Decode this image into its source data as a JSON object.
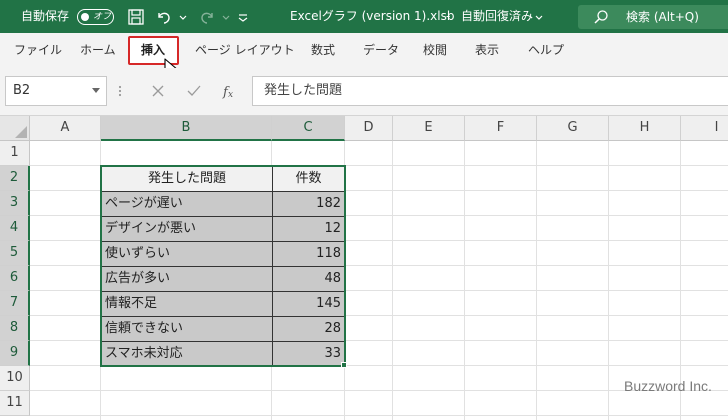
{
  "titlebar": {
    "autosave_label": "自動保存",
    "autosave_state": "オフ",
    "doc_title": "Excelグラフ (version 1).xlsb",
    "separator": "-",
    "save_status": "自動回復済み",
    "search_text": "検索 (Alt+Q)",
    "icons": [
      "save-icon",
      "undo-icon",
      "redo-icon",
      "customize-qat-icon",
      "search-icon"
    ],
    "bg_color": "#217346"
  },
  "ribbon": {
    "tabs": [
      "ファイル",
      "ホーム",
      "挿入",
      "ページ レイアウト",
      "数式",
      "データ",
      "校閲",
      "表示",
      "ヘルプ"
    ],
    "active_tab": "挿入",
    "highlight_color": "#d62828"
  },
  "formula_bar": {
    "name_box": "B2",
    "content": "発生した問題",
    "icons": [
      "cancel-icon",
      "confirm-icon",
      "function-icon"
    ]
  },
  "grid": {
    "columns": [
      "A",
      "B",
      "C",
      "D",
      "E",
      "F",
      "G",
      "H",
      "I"
    ],
    "rows": [
      "1",
      "2",
      "3",
      "4",
      "5",
      "6",
      "7",
      "8",
      "9",
      "10",
      "11"
    ],
    "table": {
      "headers": [
        "発生した問題",
        "件数"
      ],
      "rows": [
        {
          "problem": "ページが遅い",
          "count": "182"
        },
        {
          "problem": "デザインが悪い",
          "count": "12"
        },
        {
          "problem": "使いずらい",
          "count": "118"
        },
        {
          "problem": "広告が多い",
          "count": "48"
        },
        {
          "problem": "情報不足",
          "count": "145"
        },
        {
          "problem": "信頼できない",
          "count": "28"
        },
        {
          "problem": "スマホ未対応",
          "count": "33"
        }
      ]
    },
    "selection_color": "#217346"
  },
  "watermark": "Buzzword Inc."
}
